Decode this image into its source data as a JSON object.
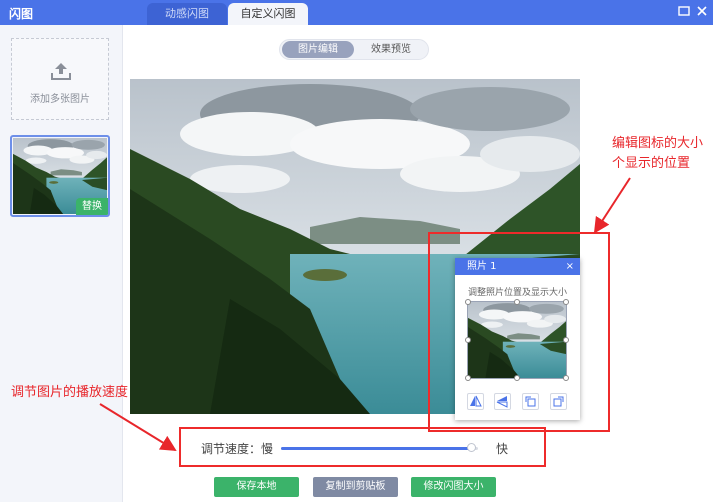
{
  "window": {
    "title": "闪图",
    "tabs": [
      {
        "label": "动感闪图",
        "active": false
      },
      {
        "label": "自定义闪图",
        "active": true
      }
    ],
    "controls": [
      "minimize-icon",
      "close-icon"
    ]
  },
  "sidebar": {
    "add_label": "添加多张图片",
    "replace_label": "替换"
  },
  "main": {
    "mode_tabs": [
      {
        "label": "图片编辑",
        "active": true
      },
      {
        "label": "效果预览",
        "active": false
      }
    ]
  },
  "photo_panel": {
    "title": "照片 1",
    "close": "×",
    "hint": "调整照片位置及显示大小",
    "tools": [
      "flip-horizontal-icon",
      "flip-vertical-icon",
      "rotate-left-icon",
      "rotate-right-icon"
    ]
  },
  "speed": {
    "label": "调节速度：慢",
    "fast_label": "快",
    "value_fraction": 0.97
  },
  "actions": {
    "save_label": "保存本地",
    "copy_label": "复制到剪贴板",
    "resize_label": "修改闪图大小"
  },
  "annotations": {
    "icon_size_line1": "编辑图标的大小",
    "icon_size_line2": "个显示的位置",
    "speed_note": "调节图片的播放速度"
  },
  "colors": {
    "accent": "#4a73e8",
    "green": "#3bb36a",
    "annotation_red": "#e8262b"
  }
}
